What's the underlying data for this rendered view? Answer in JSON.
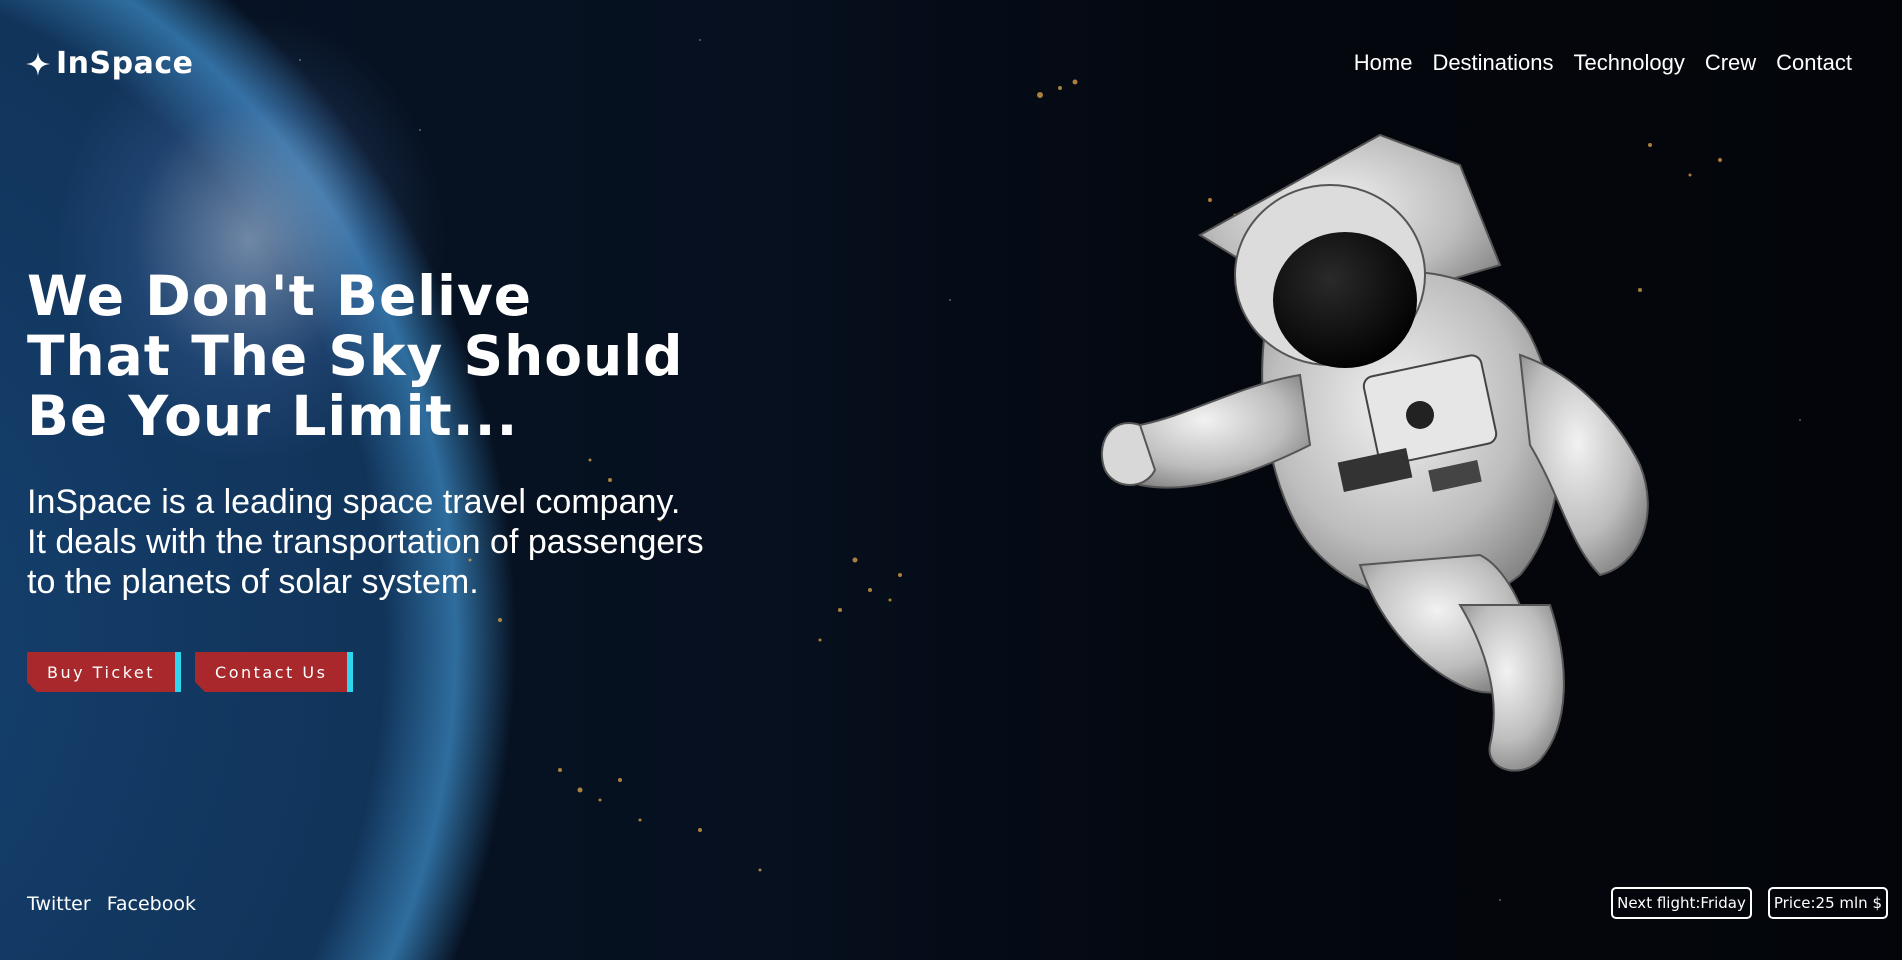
{
  "brand": {
    "name": "InSpace",
    "icon": "sparkle-star-icon"
  },
  "nav": {
    "items": [
      {
        "label": "Home"
      },
      {
        "label": "Destinations"
      },
      {
        "label": "Technology"
      },
      {
        "label": "Crew"
      },
      {
        "label": "Contact"
      }
    ]
  },
  "hero": {
    "heading_lines": [
      "We Don't Belive",
      "That The Sky Should",
      "Be Your Limit..."
    ],
    "description_lines": [
      "InSpace is a leading space travel company.",
      "It deals with the transportation of passengers",
      "to the planets of solar system."
    ]
  },
  "buttons": {
    "buy_ticket": "Buy Ticket",
    "contact_us": "Contact Us"
  },
  "social": {
    "twitter": "Twitter",
    "facebook": "Facebook"
  },
  "info": {
    "next_flight": "Next flight:Friday",
    "price": "Price:25 mln $"
  },
  "colors": {
    "button_bg": "#a8282c",
    "button_accent": "#2ed6f0",
    "text": "#ffffff",
    "background": "#05080f"
  }
}
